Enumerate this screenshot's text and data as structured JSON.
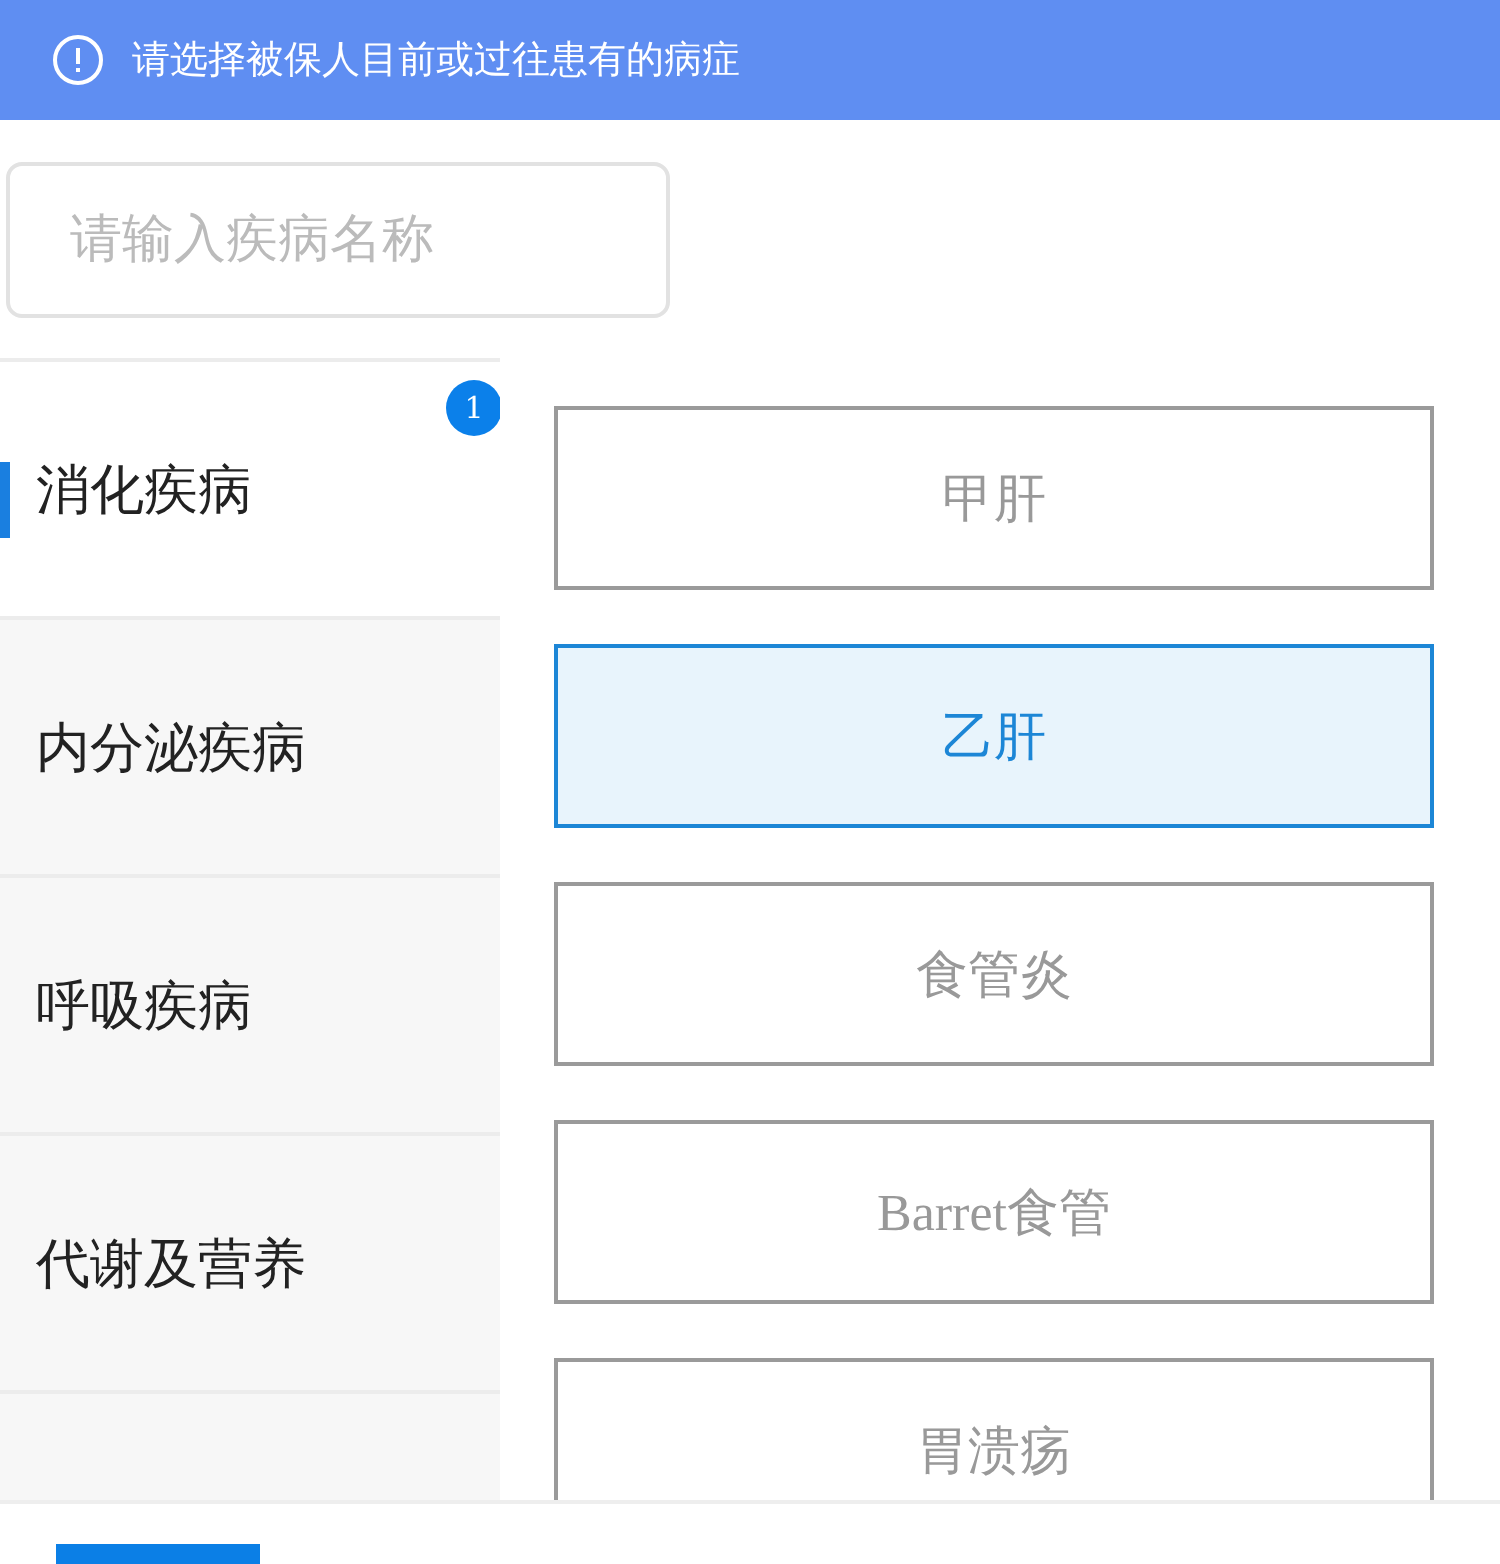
{
  "notice": {
    "text": "请选择被保人目前或过往患有的病症"
  },
  "search": {
    "placeholder": "请输入疾病名称"
  },
  "categories": [
    {
      "label": "消化疾病",
      "selected": true,
      "badge": "1"
    },
    {
      "label": "内分泌疾病",
      "selected": false
    },
    {
      "label": "呼吸疾病",
      "selected": false
    },
    {
      "label": "代谢及营养",
      "selected": false
    },
    {
      "selected": false
    }
  ],
  "diseases": [
    {
      "label": "甲肝",
      "selected": false
    },
    {
      "label": "乙肝",
      "selected": true
    },
    {
      "label": "食管炎",
      "selected": false
    },
    {
      "label": "Barret食管",
      "selected": false
    },
    {
      "label": "胃溃疡",
      "selected": false
    }
  ]
}
